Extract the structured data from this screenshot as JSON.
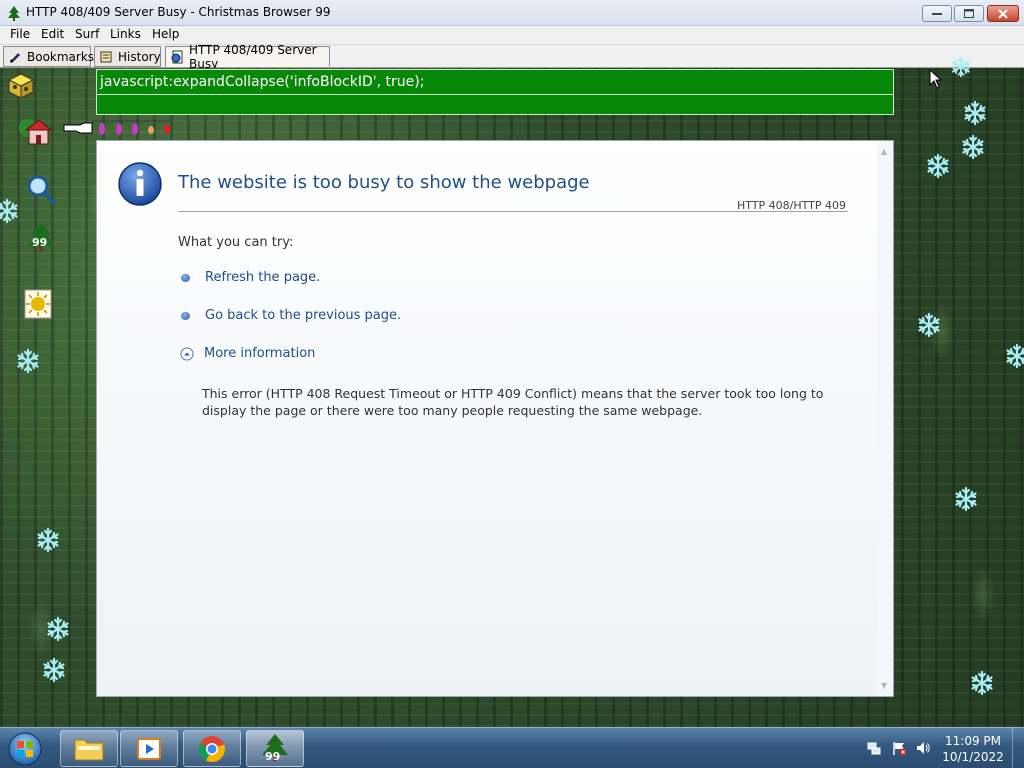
{
  "window": {
    "title": "HTTP 408/409 Server Busy - Christmas Browser 99"
  },
  "menu": {
    "items": [
      "File",
      "Edit",
      "Surf",
      "Links",
      "Help"
    ]
  },
  "tabs": [
    {
      "label": "Bookmarks",
      "icon": "pen-icon"
    },
    {
      "label": "History",
      "icon": "scroll-icon"
    },
    {
      "label": "HTTP 408/409 Server Busy",
      "icon": "page-globe-icon"
    }
  ],
  "address": {
    "value": "javascript:expandCollapse('infoBlockID', true);"
  },
  "sidebar": {
    "badge_number": "99"
  },
  "error_page": {
    "title": "The website is too busy to show the webpage",
    "code": "HTTP 408/HTTP 409",
    "try_label": "What you can try:",
    "actions": [
      {
        "label": "Refresh the page."
      },
      {
        "label": "Go back to the previous page."
      }
    ],
    "more_info_label": "More information",
    "description": "This error (HTTP 408 Request Timeout or HTTP 409 Conflict) means that the server took too long to display the page or there were too many people requesting the same webpage."
  },
  "taskbar": {
    "christmas_badge": "99",
    "clock_time": "11:09 PM",
    "clock_date": "10/1/2022"
  },
  "colors": {
    "address_bg": "#088808",
    "link_blue": "#1f4e8a",
    "snowflake": "#a8eef8"
  }
}
